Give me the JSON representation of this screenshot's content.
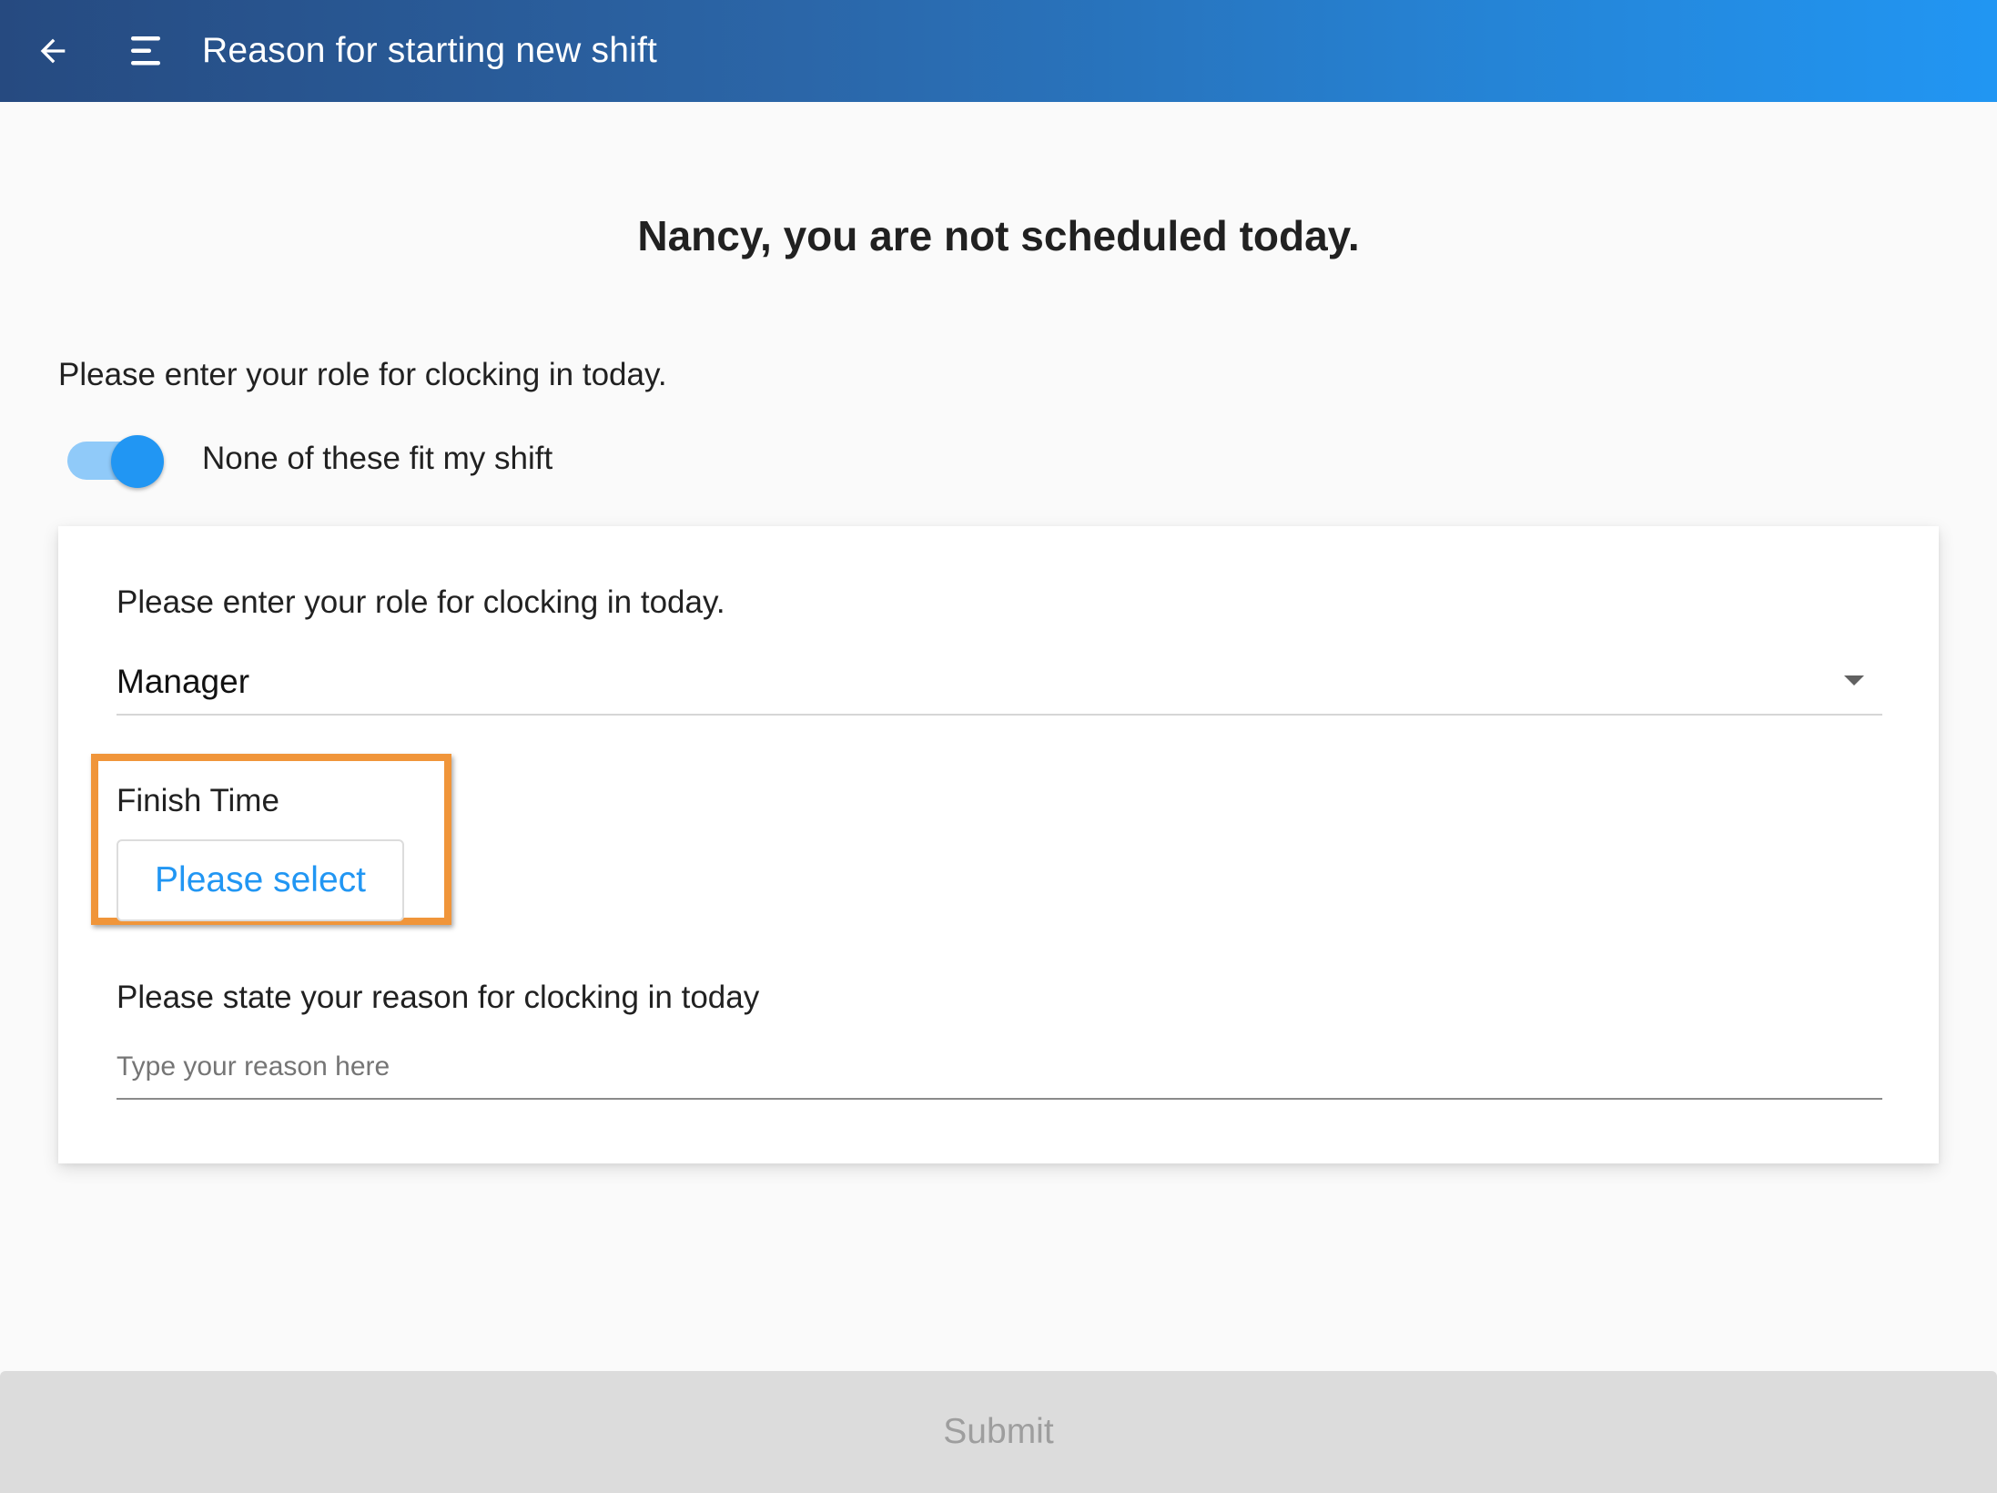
{
  "app_bar": {
    "title": "Reason for starting new shift",
    "back_icon": "arrow-left-icon",
    "menu_icon": "menu-icon"
  },
  "heading": "Nancy, you are not scheduled today.",
  "role_prompt": "Please enter your role for clocking in today.",
  "toggle": {
    "label": "None of these fit my shift",
    "checked": true
  },
  "card": {
    "role_prompt": "Please enter your role for clocking in today.",
    "role_select": {
      "value": "Manager",
      "caret_icon": "caret-down-icon"
    },
    "finish_time": {
      "label": "Finish Time",
      "button_label": "Please select"
    },
    "reason": {
      "label": "Please state your reason for clocking in today",
      "placeholder": "Type your reason here",
      "value": ""
    }
  },
  "submit_label": "Submit",
  "colors": {
    "primary": "#2196f3",
    "appbar_start": "#264a80",
    "highlight": "#f0953a",
    "submit_disabled_bg": "#dcdcdc"
  }
}
